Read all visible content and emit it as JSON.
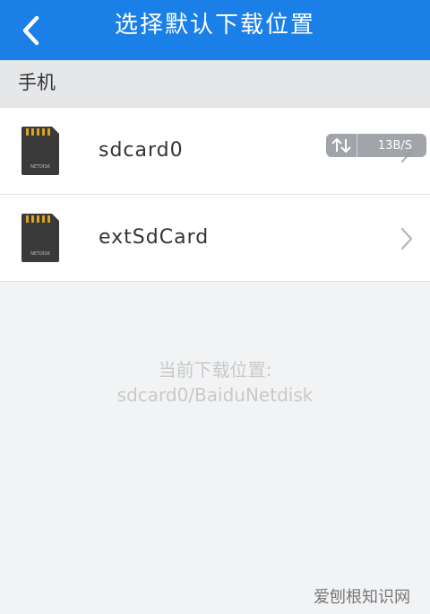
{
  "header": {
    "title": "选择默认下载位置"
  },
  "section": {
    "title": "手机"
  },
  "storage_items": [
    {
      "label": "sdcard0",
      "icon_text": "NETDISK"
    },
    {
      "label": "extSdCard",
      "icon_text": "NETDISK"
    }
  ],
  "speed_badge": {
    "value": "13B/S"
  },
  "current_location": {
    "label": "当前下载位置:",
    "path": "sdcard0/BaiduNetdisk"
  },
  "watermark": {
    "text": "爱刨根知识网"
  },
  "colors": {
    "header_bg": "#1a7fe6",
    "page_bg": "#f2f3f5",
    "section_bg": "#e6e7e9"
  }
}
